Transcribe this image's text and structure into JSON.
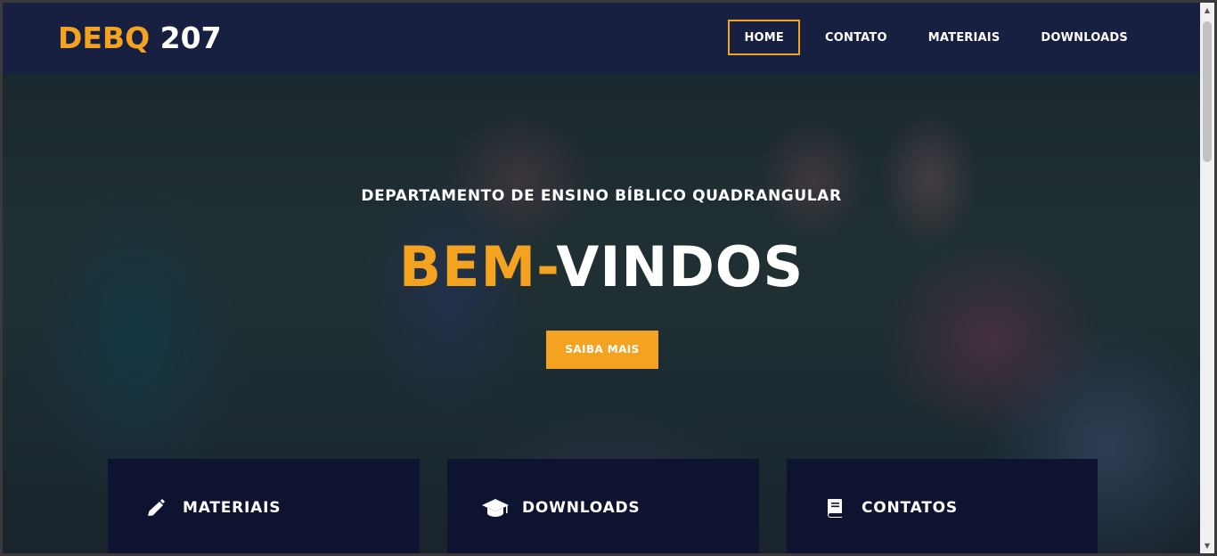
{
  "brand": {
    "part1": "DEBQ",
    "part2": "207",
    "accent_color": "#f4a320"
  },
  "nav": {
    "items": [
      {
        "label": "HOME",
        "active": true
      },
      {
        "label": "CONTATO",
        "active": false
      },
      {
        "label": "MATERIAIS",
        "active": false
      },
      {
        "label": "DOWNLOADS",
        "active": false
      }
    ]
  },
  "hero": {
    "subtitle": "DEPARTAMENTO DE ENSINO BÍBLICO QUADRANGULAR",
    "headline_accent": "BEM-",
    "headline_rest": "VINDOS",
    "cta_label": "SAIBA MAIS"
  },
  "cards": [
    {
      "icon": "pencil-icon",
      "title": "MATERIAIS"
    },
    {
      "icon": "graduation-cap-icon",
      "title": "DOWNLOADS"
    },
    {
      "icon": "book-icon",
      "title": "CONTATOS"
    }
  ]
}
